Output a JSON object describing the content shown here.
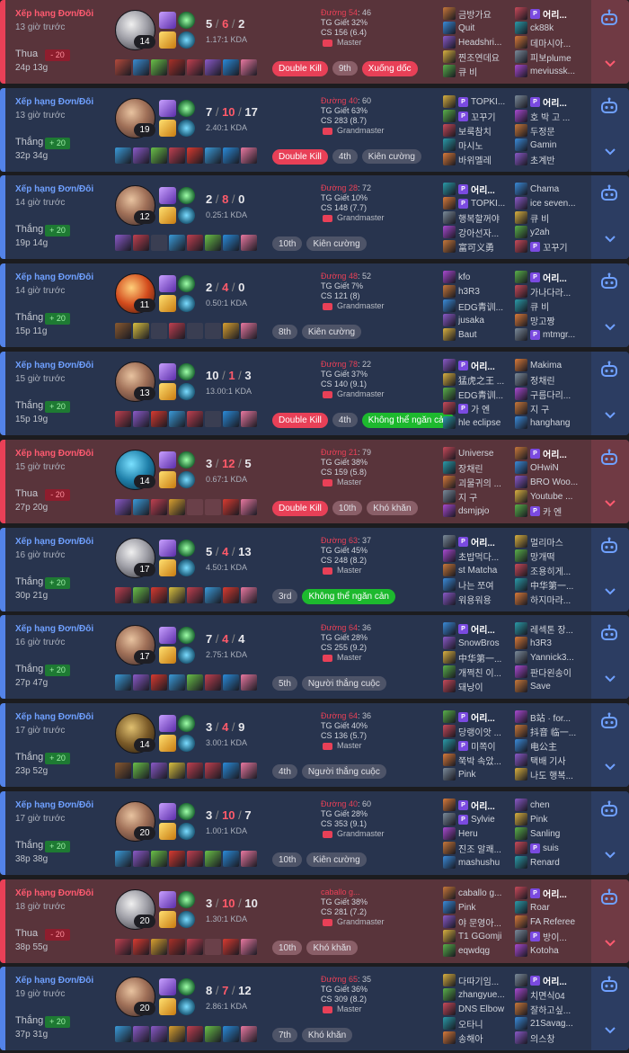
{
  "colors": {
    "loss": "#e84057",
    "win": "#5383e8",
    "loss_bg": "#59343b",
    "win_bg": "#28344e",
    "mk": "#e84057",
    "op": "#1db92e"
  },
  "icons": {
    "ai": "ai-bot-icon",
    "expand": "chevron-down-icon",
    "tier": "tier-emblem-icon",
    "party": "party-badge-icon"
  },
  "matches": [
    {
      "result": "loss",
      "queue": "Xếp hạng Đơn/Đôi",
      "ago": "13 giờ trước",
      "res": "Thua",
      "lp": "- 20",
      "duration": "24p 13g",
      "champ_cls": "c1",
      "level": "14",
      "k": "5",
      "d": "6",
      "a": "2",
      "kda_ratio": "1.17:1 KDA",
      "items": [
        "#b44a3c",
        "#3a8cd0",
        "#6ac048",
        "#a83028",
        "#c04050",
        "#8a5ac8",
        "#2a8ad8",
        "#e878a0"
      ],
      "tags": [
        {
          "t": "Double Kill",
          "c": "mk"
        },
        {
          "t": "9th",
          "c": "pl"
        },
        {
          "t": "Xuống dốc",
          "c": "mk"
        }
      ],
      "road": "Đường 54",
      "road_n": ": 46",
      "kp": "TG Giết 32%",
      "cs": "CS 156 (6.4)",
      "tier": "Master",
      "team1": [
        {
          "n": "금방가요"
        },
        {
          "n": "Quit"
        },
        {
          "n": "Headshri..."
        },
        {
          "n": "찐조연데요"
        },
        {
          "n": "큐 비"
        }
      ],
      "team2": [
        {
          "n": "어리...",
          "me": true,
          "b": true
        },
        {
          "n": "ck88k"
        },
        {
          "n": "데마시아..."
        },
        {
          "n": "피보plume"
        },
        {
          "n": "meviussk..."
        }
      ]
    },
    {
      "result": "win",
      "queue": "Xếp hạng Đơn/Đôi",
      "ago": "13 giờ trước",
      "res": "Thắng",
      "lp": "+ 20",
      "duration": "32p 34g",
      "champ_cls": "",
      "level": "19",
      "k": "7",
      "d": "10",
      "a": "17",
      "kda_ratio": "2.40:1 KDA",
      "items": [
        "#3a9ad8",
        "#8a5ac8",
        "#6ac048",
        "#c04050",
        "#d83a30",
        "#3a9ad8",
        "#2a8ad8",
        "#e878a0"
      ],
      "tags": [
        {
          "t": "Double Kill",
          "c": "mk"
        },
        {
          "t": "4th",
          "c": "pl"
        },
        {
          "t": "Kiên cường",
          "c": "pl"
        }
      ],
      "road": "Đường 40",
      "road_n": ": 60",
      "kp": "TG Giết 63%",
      "cs": "CS 283 (8.7)",
      "tier": "Grandmaster",
      "team1": [
        {
          "n": "TOPKI...",
          "b": true
        },
        {
          "n": "꼬꾸기",
          "b": true
        },
        {
          "n": "보룩참치"
        },
        {
          "n": "마시노"
        },
        {
          "n": "바위멜레"
        }
      ],
      "team2": [
        {
          "n": "어리...",
          "me": true,
          "b": true
        },
        {
          "n": "호 박 고 ..."
        },
        {
          "n": "두정문"
        },
        {
          "n": "Gamin"
        },
        {
          "n": "초계반"
        }
      ]
    },
    {
      "result": "win",
      "queue": "Xếp hạng Đơn/Đôi",
      "ago": "14 giờ trước",
      "res": "Thắng",
      "lp": "+ 20",
      "duration": "19p 14g",
      "champ_cls": "",
      "level": "12",
      "k": "2",
      "d": "8",
      "a": "0",
      "kda_ratio": "0.25:1 KDA",
      "items": [
        "#8a5ac8",
        "#c04050",
        "",
        "#3a9ad8",
        "#c04050",
        "#6ac048",
        "#2a8ad8",
        "#e878a0"
      ],
      "tags": [
        {
          "t": "10th",
          "c": "pl"
        },
        {
          "t": "Kiên cường",
          "c": "pl"
        }
      ],
      "road": "Đường 28",
      "road_n": ": 72",
      "kp": "TG Giết 10%",
      "cs": "CS 148 (7.7)",
      "tier": "Grandmaster",
      "team1": [
        {
          "n": "어리...",
          "me": true,
          "b": true
        },
        {
          "n": "TOPKI...",
          "b": true
        },
        {
          "n": "행복할꺼야"
        },
        {
          "n": "강아선자..."
        },
        {
          "n": "富可义勇"
        }
      ],
      "team2": [
        {
          "n": "Chama"
        },
        {
          "n": "ice seven..."
        },
        {
          "n": "큐 비"
        },
        {
          "n": "y2ah"
        },
        {
          "n": "꼬꾸기",
          "b": true
        }
      ]
    },
    {
      "result": "win",
      "queue": "Xếp hạng Đơn/Đôi",
      "ago": "14 giờ trước",
      "res": "Thắng",
      "lp": "+ 20",
      "duration": "15p 11g",
      "champ_cls": "c2",
      "level": "11",
      "k": "2",
      "d": "4",
      "a": "0",
      "kda_ratio": "0.50:1 KDA",
      "items": [
        "#8a5a30",
        "#d8c040",
        "",
        "#c04050",
        "",
        "",
        "#d8a030",
        "#e878a0"
      ],
      "tags": [
        {
          "t": "8th",
          "c": "pl"
        },
        {
          "t": "Kiên cường",
          "c": "pl"
        }
      ],
      "road": "Đường 48",
      "road_n": ": 52",
      "kp": "TG Giết 7%",
      "cs": "CS 121 (8)",
      "tier": "Grandmaster",
      "team1": [
        {
          "n": "kfo"
        },
        {
          "n": "h3R3"
        },
        {
          "n": "EDG青训..."
        },
        {
          "n": "jusaka"
        },
        {
          "n": "Baut"
        }
      ],
      "team2": [
        {
          "n": "어리...",
          "me": true,
          "b": true
        },
        {
          "n": "가나다라..."
        },
        {
          "n": "큐 비"
        },
        {
          "n": "망고짱"
        },
        {
          "n": "mtmgr...",
          "b": true
        }
      ]
    },
    {
      "result": "win",
      "queue": "Xếp hạng Đơn/Đôi",
      "ago": "15 giờ trước",
      "res": "Thắng",
      "lp": "+ 20",
      "duration": "15p 19g",
      "champ_cls": "",
      "level": "13",
      "k": "10",
      "d": "1",
      "a": "3",
      "kda_ratio": "13.00:1 KDA",
      "items": [
        "#c04050",
        "#8a5ac8",
        "#d83a30",
        "#3a9ad8",
        "#c04050",
        "",
        "#2a8ad8",
        "#e878a0"
      ],
      "tags": [
        {
          "t": "Double Kill",
          "c": "mk"
        },
        {
          "t": "4th",
          "c": "pl"
        },
        {
          "t": "Không thể ngăn cản",
          "c": "op"
        }
      ],
      "road": "Đường 78",
      "road_n": ": 22",
      "kp": "TG Giết 37%",
      "cs": "CS 140 (9.1)",
      "tier": "Grandmaster",
      "team1": [
        {
          "n": "어리...",
          "me": true,
          "b": true
        },
        {
          "n": "猛虎之王 ..."
        },
        {
          "n": "EDG青训..."
        },
        {
          "n": "가 엔",
          "b": true
        },
        {
          "n": "hle eclipse"
        }
      ],
      "team2": [
        {
          "n": "Makima"
        },
        {
          "n": "정채린"
        },
        {
          "n": "구름다리..."
        },
        {
          "n": "지 구"
        },
        {
          "n": "hanghang"
        }
      ]
    },
    {
      "result": "loss",
      "queue": "Xếp hạng Đơn/Đôi",
      "ago": "15 giờ trước",
      "res": "Thua",
      "lp": "- 20",
      "duration": "27p 20g",
      "champ_cls": "c3",
      "level": "14",
      "k": "3",
      "d": "12",
      "a": "5",
      "kda_ratio": "0.67:1 KDA",
      "items": [
        "#8a5ac8",
        "#3a9ad8",
        "#c04050",
        "#d8a030",
        "",
        "",
        "#d83a30",
        "#e878a0"
      ],
      "tags": [
        {
          "t": "Double Kill",
          "c": "mk"
        },
        {
          "t": "10th",
          "c": "pl"
        },
        {
          "t": "Khó khăn",
          "c": "pl"
        }
      ],
      "road": "Đường 21",
      "road_n": ": 79",
      "kp": "TG Giết 38%",
      "cs": "CS 159 (5.8)",
      "tier": "Master",
      "team1": [
        {
          "n": "Universe"
        },
        {
          "n": "장채린"
        },
        {
          "n": "괴물귀의 ..."
        },
        {
          "n": "지 구"
        },
        {
          "n": "dsmjpjo"
        }
      ],
      "team2": [
        {
          "n": "어리...",
          "me": true,
          "b": true
        },
        {
          "n": "OHwiN"
        },
        {
          "n": "BRO Woo..."
        },
        {
          "n": "Youtube ..."
        },
        {
          "n": "카 엔",
          "b": true
        }
      ]
    },
    {
      "result": "win",
      "queue": "Xếp hạng Đơn/Đôi",
      "ago": "16 giờ trước",
      "res": "Thắng",
      "lp": "+ 20",
      "duration": "30p 21g",
      "champ_cls": "c1",
      "level": "17",
      "k": "5",
      "d": "4",
      "a": "13",
      "kda_ratio": "4.50:1 KDA",
      "items": [
        "#c04050",
        "#6ac048",
        "#d83a30",
        "#d8c040",
        "#c04050",
        "#3a9ad8",
        "#d83a30",
        "#e878a0"
      ],
      "tags": [
        {
          "t": "3rd",
          "c": "pl"
        },
        {
          "t": "Không thể ngăn cản",
          "c": "op"
        }
      ],
      "road": "Đường 63",
      "road_n": ": 37",
      "kp": "TG Giết 45%",
      "cs": "CS 248 (8.2)",
      "tier": "Master",
      "team1": [
        {
          "n": "어리...",
          "me": true,
          "b": true
        },
        {
          "n": "초밥먹다..."
        },
        {
          "n": "st Matcha"
        },
        {
          "n": "나는 쪼여"
        },
        {
          "n": "워용워용"
        }
      ],
      "team2": [
        {
          "n": "멀리마스"
        },
        {
          "n": "망개떡"
        },
        {
          "n": "조용히게..."
        },
        {
          "n": "中华第一..."
        },
        {
          "n": "하지마라..."
        }
      ]
    },
    {
      "result": "win",
      "queue": "Xếp hạng Đơn/Đôi",
      "ago": "16 giờ trước",
      "res": "Thắng",
      "lp": "+ 20",
      "duration": "27p 47g",
      "champ_cls": "",
      "level": "17",
      "k": "7",
      "d": "4",
      "a": "4",
      "kda_ratio": "2.75:1 KDA",
      "items": [
        "#3a9ad8",
        "#8a5ac8",
        "#d83a30",
        "#3a9ad8",
        "#6ac048",
        "#c04050",
        "#2a8ad8",
        "#e878a0"
      ],
      "tags": [
        {
          "t": "5th",
          "c": "pl"
        },
        {
          "t": "Người thắng cuộc",
          "c": "pl"
        }
      ],
      "road": "Đường 64",
      "road_n": ": 36",
      "kp": "TG Giết 28%",
      "cs": "CS 255 (9.2)",
      "tier": "Master",
      "team1": [
        {
          "n": "어리...",
          "me": true,
          "b": true
        },
        {
          "n": "SnowBros"
        },
        {
          "n": "中华第一..."
        },
        {
          "n": "개쩍친 이..."
        },
        {
          "n": "돼낭이"
        }
      ],
      "team2": [
        {
          "n": "레섹톤 장..."
        },
        {
          "n": "h3R3"
        },
        {
          "n": "Yannick3..."
        },
        {
          "n": "판다왼송이"
        },
        {
          "n": "Save"
        }
      ]
    },
    {
      "result": "win",
      "queue": "Xếp hạng Đơn/Đôi",
      "ago": "17 giờ trước",
      "res": "Thắng",
      "lp": "+ 20",
      "duration": "23p 52g",
      "champ_cls": "c4",
      "level": "14",
      "k": "3",
      "d": "4",
      "a": "9",
      "kda_ratio": "3.00:1 KDA",
      "items": [
        "#8a5a30",
        "#6ac048",
        "#8a5ac8",
        "#d8c040",
        "#c04050",
        "#c04050",
        "#2a8ad8",
        "#e878a0"
      ],
      "tags": [
        {
          "t": "4th",
          "c": "pl"
        },
        {
          "t": "Người thắng cuộc",
          "c": "pl"
        }
      ],
      "road": "Đường 64",
      "road_n": ": 36",
      "kp": "TG Giết 40%",
      "cs": "CS 136 (5.7)",
      "tier": "Master",
      "team1": [
        {
          "n": "어리...",
          "me": true,
          "b": true
        },
        {
          "n": "당랭이앗 ..."
        },
        {
          "n": "미쪽이",
          "b": true
        },
        {
          "n": "쭉박 속았..."
        },
        {
          "n": "Pink"
        }
      ],
      "team2": [
        {
          "n": "B站 · for..."
        },
        {
          "n": "抖音 临一..."
        },
        {
          "n": "电公主"
        },
        {
          "n": "택배 기사"
        },
        {
          "n": "나도 행복..."
        }
      ]
    },
    {
      "result": "win",
      "queue": "Xếp hạng Đơn/Đôi",
      "ago": "17 giờ trước",
      "res": "Thắng",
      "lp": "+ 20",
      "duration": "38p 38g",
      "champ_cls": "",
      "level": "20",
      "k": "3",
      "d": "10",
      "a": "7",
      "kda_ratio": "1.00:1 KDA",
      "items": [
        "#3a9ad8",
        "#8a5ac8",
        "#6ac048",
        "#d83a30",
        "#c04050",
        "#6ac048",
        "#2a8ad8",
        "#e878a0"
      ],
      "tags": [
        {
          "t": "10th",
          "c": "pl"
        },
        {
          "t": "Kiên cường",
          "c": "pl"
        }
      ],
      "road": "Đường 40",
      "road_n": ": 60",
      "kp": "TG Giết 28%",
      "cs": "CS 353 (9.1)",
      "tier": "Grandmaster",
      "team1": [
        {
          "n": "어리...",
          "me": true,
          "b": true
        },
        {
          "n": "Sylvie",
          "b": true
        },
        {
          "n": "Heru"
        },
        {
          "n": "진조 알쾌..."
        },
        {
          "n": "mashushu"
        }
      ],
      "team2": [
        {
          "n": "chen"
        },
        {
          "n": "Pink"
        },
        {
          "n": "Sanling"
        },
        {
          "n": "suis",
          "b": true
        },
        {
          "n": "Renard"
        }
      ]
    },
    {
      "result": "loss",
      "queue": "Xếp hạng Đơn/Đôi",
      "ago": "18 giờ trước",
      "res": "Thua",
      "lp": "- 20",
      "duration": "38p 55g",
      "champ_cls": "c1",
      "level": "20",
      "k": "3",
      "d": "10",
      "a": "10",
      "kda_ratio": "1.30:1 KDA",
      "items": [
        "#c04050",
        "#d83a30",
        "#d8a030",
        "#a83028",
        "#c04050",
        "",
        "#d83a30",
        "#e878a0"
      ],
      "tags": [
        {
          "t": "10th",
          "c": "pl"
        },
        {
          "t": "Khó khăn",
          "c": "pl"
        }
      ],
      "road": "caballo g...",
      "road_n": "",
      "kp": "TG Giết 38%",
      "cs": "CS 281 (7.2)",
      "tier": "Grandmaster",
      "team1": [
        {
          "n": "caballo g..."
        },
        {
          "n": "Pink"
        },
        {
          "n": "야 문영아..."
        },
        {
          "n": "T1 GGomji"
        },
        {
          "n": "eqwdqg"
        }
      ],
      "team2": [
        {
          "n": "어리...",
          "me": true,
          "b": true
        },
        {
          "n": "Roar"
        },
        {
          "n": "FA Referee"
        },
        {
          "n": "방이...",
          "b": true
        },
        {
          "n": "Kotoha"
        }
      ]
    },
    {
      "result": "win",
      "queue": "Xếp hạng Đơn/Đôi",
      "ago": "19 giờ trước",
      "res": "Thắng",
      "lp": "+ 20",
      "duration": "37p 31g",
      "champ_cls": "",
      "level": "20",
      "k": "8",
      "d": "7",
      "a": "12",
      "kda_ratio": "2.86:1 KDA",
      "items": [
        "#3a9ad8",
        "#8a5ac8",
        "#8a5ac8",
        "#d8a030",
        "#c04050",
        "#6ac048",
        "#2a8ad8",
        "#e878a0"
      ],
      "tags": [
        {
          "t": "7th",
          "c": "pl"
        },
        {
          "t": "Khó khăn",
          "c": "pl"
        }
      ],
      "road": "Đường 65",
      "road_n": ": 35",
      "kp": "TG Giết 36%",
      "cs": "CS 309 (8.2)",
      "tier": "Master",
      "team1": [
        {
          "n": "다따기임..."
        },
        {
          "n": "zhangyue..."
        },
        {
          "n": "DNS Elbow"
        },
        {
          "n": "오타니"
        },
        {
          "n": "송해아"
        }
      ],
      "team2": [
        {
          "n": "어리...",
          "me": true,
          "b": true
        },
        {
          "n": "치면식04"
        },
        {
          "n": "잘하고싶..."
        },
        {
          "n": "21Savag..."
        },
        {
          "n": "의스창"
        }
      ]
    }
  ]
}
